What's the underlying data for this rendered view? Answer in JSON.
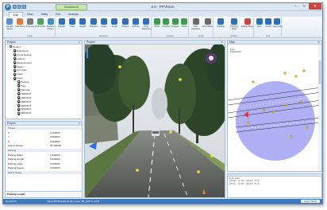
{
  "window": {
    "title": "2.0 - PPVision",
    "context_tab": "Workbench",
    "logo_glyph": "P",
    "buttons": {
      "minimize": "–",
      "maximize": "□",
      "close": "✕"
    }
  },
  "ribbon_tabs": [
    "Edit",
    "View",
    "Utility",
    "Exit",
    "Analysis"
  ],
  "ribbon_active_tab": "Edit",
  "ribbon": {
    "groups": [
      {
        "caption": "Data",
        "buttons": [
          {
            "label": "Sample Mode",
            "icon": "sample-icon",
            "color": "#5b8fd0"
          },
          {
            "label": "Add Point",
            "icon": "add-point-icon",
            "color": "#e07b39"
          },
          {
            "label": "Property",
            "icon": "property-icon",
            "color": "#7a7a7a"
          },
          {
            "label": "Point Valu",
            "icon": "point-value-icon",
            "color": "#4aa35a"
          },
          {
            "label": "Surface Detect",
            "icon": "surface-icon",
            "color": "#3f8fc6"
          }
        ]
      },
      {
        "caption": "Measure",
        "buttons": [
          {
            "label": "Length",
            "icon": "length-icon",
            "color": "#2f6fb8"
          },
          {
            "label": "Area",
            "icon": "area-icon",
            "color": "#2f6fb8"
          },
          {
            "label": "Height",
            "icon": "height-icon",
            "color": "#2f6fb8"
          },
          {
            "label": "Transfer",
            "icon": "transfer-icon",
            "color": "#2f6fb8"
          },
          {
            "label": "Slope",
            "icon": "slope-icon",
            "color": "#2f6fb8"
          },
          {
            "label": "Angle",
            "icon": "angle-icon",
            "color": "#2f6fb8"
          },
          {
            "label": "Volume",
            "icon": "volume-icon",
            "color": "#2f6fb8"
          },
          {
            "label": "Surface",
            "icon": "surface-measure-icon",
            "color": "#2f6fb8"
          },
          {
            "label": "Pole Distance",
            "icon": "pole-distance-icon",
            "color": "#2f6fb8"
          }
        ]
      },
      {
        "caption": "Detect",
        "buttons": [
          {
            "label": "Point",
            "icon": "point-icon",
            "color": "#3d9b4d"
          },
          {
            "label": "Polyline",
            "icon": "polyline-icon",
            "color": "#3d9b4d"
          },
          {
            "label": "Polygon",
            "icon": "polygon-icon",
            "color": "#3d9b4d"
          },
          {
            "label": "Plane",
            "icon": "plane-icon",
            "color": "#3d9b4d"
          }
        ]
      },
      {
        "caption": "Draw",
        "buttons": [
          {
            "label": "Dot Intersect",
            "icon": "dot-intersect-icon",
            "color": "#6a6a6a"
          },
          {
            "label": "Dot Offset",
            "icon": "dot-offset-icon",
            "color": "#6a6a6a"
          }
        ]
      },
      {
        "caption": "Others",
        "buttons": [
          {
            "label": "Parking",
            "icon": "parking-icon",
            "color": "#2f6fb8"
          },
          {
            "label": "Parking Snap",
            "icon": "parking-snap-icon",
            "color": "#2f6fb8"
          },
          {
            "label": "Delete Snap",
            "icon": "delete-snap-icon",
            "color": "#c44a3f"
          }
        ]
      },
      {
        "caption": "Tool",
        "buttons": [
          {
            "label": "Eye",
            "icon": "eye-icon",
            "color": "#2f6fb8"
          },
          {
            "label": "Count",
            "icon": "count-icon",
            "color": "#2f6fb8"
          },
          {
            "label": "Geometry",
            "icon": "geometry-icon",
            "color": "#2f6fb8"
          }
        ]
      }
    ]
  },
  "project_panel": {
    "title": "Project",
    "tree": [
      {
        "label": "Project",
        "depth": 0,
        "toggle": "−",
        "checked": false
      },
      {
        "label": "Pointcloud",
        "depth": 1,
        "toggle": "",
        "checked": true
      },
      {
        "label": "Cross Section",
        "depth": 1,
        "toggle": "",
        "checked": true
      },
      {
        "label": "Feature",
        "depth": 1,
        "toggle": "",
        "checked": true
      },
      {
        "label": "Measurement",
        "depth": 1,
        "toggle": "",
        "checked": true
      },
      {
        "label": "Model",
        "depth": 1,
        "toggle": "",
        "checked": true
      },
      {
        "label": "Ctrl Point",
        "depth": 1,
        "toggle": "",
        "checked": true
      },
      {
        "label": "Track",
        "depth": 1,
        "toggle": "",
        "checked": true
      },
      {
        "label": "Layer",
        "depth": 1,
        "toggle": "−",
        "checked": true
      },
      {
        "label": "Parking",
        "depth": 2,
        "toggle": "",
        "checked": true
      },
      {
        "label": "Tree",
        "depth": 2,
        "toggle": "",
        "checked": true
      },
      {
        "label": "Manhole",
        "depth": 2,
        "toggle": "",
        "checked": true
      },
      {
        "label": "1DPOINT",
        "depth": 2,
        "toggle": "",
        "checked": true
      },
      {
        "label": "2DPOINT",
        "depth": 2,
        "toggle": "",
        "checked": true
      },
      {
        "label": "3DPOINT",
        "depth": 2,
        "toggle": "",
        "checked": true
      },
      {
        "label": "4DPOINT",
        "depth": 2,
        "toggle": "",
        "checked": true
      },
      {
        "label": "5DPOINT",
        "depth": 2,
        "toggle": "",
        "checked": true
      },
      {
        "label": "6DPOINT",
        "depth": 2,
        "toggle": "",
        "checked": true
      }
    ]
  },
  "property_panel": {
    "title": "Project",
    "rows": [
      {
        "key": "Others",
        "value": "",
        "category": true
      },
      {
        "key": "X",
        "value": "0.000000",
        "category": false
      },
      {
        "key": "Y",
        "value": "0.000000",
        "category": false
      },
      {
        "key": "Z",
        "value": "0.000000",
        "category": false
      },
      {
        "key": "History Range",
        "value": "25.000000",
        "category": false
      },
      {
        "key": "Parking",
        "value": "",
        "category": true
      },
      {
        "key": "Parking Width",
        "value": "2.500000",
        "category": false
      },
      {
        "key": "Parking Length",
        "value": "5.000000",
        "category": false
      },
      {
        "key": "Parking Angle",
        "value": "0.000000",
        "category": false
      },
      {
        "key": "Parking Space",
        "value": "0.000000",
        "category": false
      },
      {
        "key": "Select shape",
        "value": "",
        "category": true
      }
    ],
    "footer": "Parking Length"
  },
  "viewer": {
    "title": "Project",
    "close": "✕"
  },
  "map_panel": {
    "title": "Map",
    "close": "✕",
    "scale": "10m"
  },
  "output_panel": {
    "lines": [
      "2.5 size",
      "error: 0.71; skill: 5.1",
      "error: 0.97; skill: 5.1"
    ]
  },
  "status_bar": {
    "left": "No 1/3 0.5",
    "center": "frame:00730;track:24.01s;   pose: 86_pitch 0_roll 0",
    "right_button": "Login Ticket"
  },
  "colors": {
    "accent": "#3f79bc",
    "map_circle": "#7b7cf2",
    "map_marker": "#e0c020",
    "sky": "#e8ecef"
  }
}
